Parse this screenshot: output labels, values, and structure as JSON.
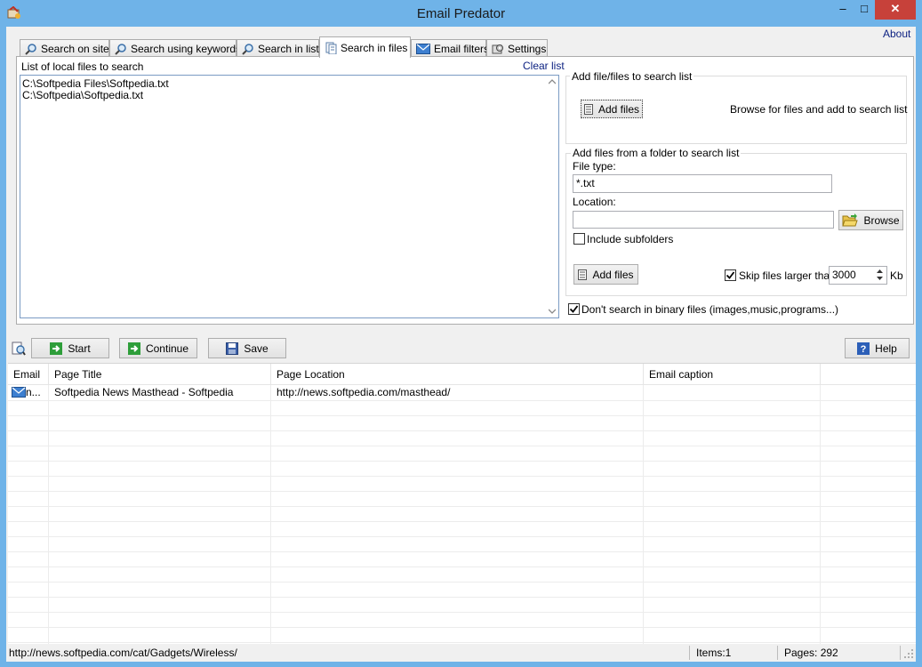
{
  "window": {
    "title": "Email Predator",
    "about": "About",
    "min": "–",
    "max": "□",
    "close": "✕"
  },
  "tabs": [
    {
      "label": "Search on site",
      "icon": "magnifier-icon"
    },
    {
      "label": "Search using keywords",
      "icon": "magnifier-icon"
    },
    {
      "label": "Search in list",
      "icon": "magnifier-icon"
    },
    {
      "label": "Search in files",
      "icon": "document-icon",
      "active": true
    },
    {
      "label": "Email filters",
      "icon": "envelope-icon"
    },
    {
      "label": "Settings",
      "icon": "gear-icon"
    }
  ],
  "files_panel": {
    "title": "List of local files to search",
    "clear": "Clear list",
    "files": [
      "C:\\Softpedia Files\\Softpedia.txt",
      "C:\\Softpedia\\Softpedia.txt"
    ]
  },
  "add_files_group": {
    "legend": "Add file/files to search list",
    "button": "Add files",
    "description": "Browse for files and add to search list"
  },
  "folder_group": {
    "legend": "Add files from a folder to search list",
    "file_type_label": "File type:",
    "file_type_value": "*.txt",
    "location_label": "Location:",
    "location_value": "",
    "browse": "Browse",
    "include_subfolders": "Include subfolders",
    "include_subfolders_checked": false,
    "add_button": "Add files",
    "skip_label": "Skip files larger than",
    "skip_checked": true,
    "skip_value": "3000",
    "skip_unit": "Kb"
  },
  "binary_option": {
    "label": "Don't search in binary files (images,music,programs...)",
    "checked": true
  },
  "toolbar": {
    "start": "Start",
    "continue": "Continue",
    "save": "Save",
    "help": "Help"
  },
  "results": {
    "columns": [
      "Email",
      "Page Title",
      "Page Location",
      "Email caption"
    ],
    "rows": [
      {
        "email": "n...",
        "title": "Softpedia News Masthead - Softpedia",
        "location": "http://news.softpedia.com/masthead/",
        "caption": ""
      }
    ]
  },
  "statusbar": {
    "url": "http://news.softpedia.com/cat/Gadgets/Wireless/",
    "items": "Items:1",
    "pages": "Pages: 292"
  },
  "colors": {
    "accent_link": "#0a1f80",
    "title_bar": "#6fb3e8",
    "close": "#c7413a"
  }
}
